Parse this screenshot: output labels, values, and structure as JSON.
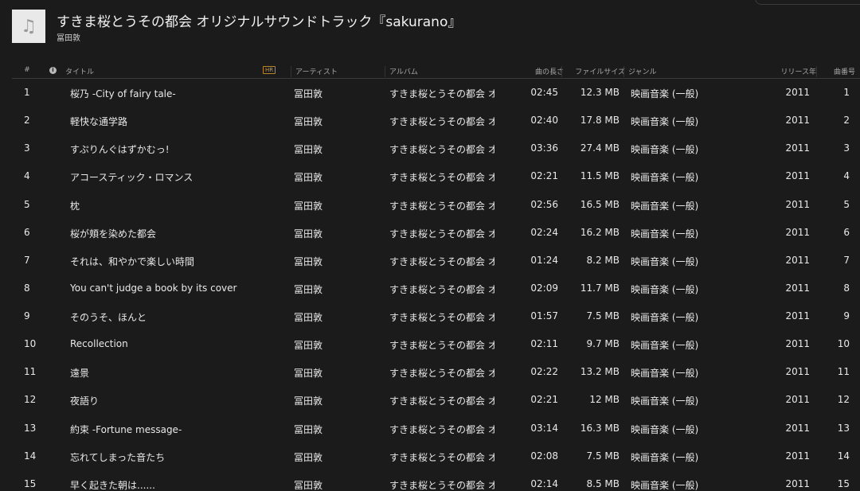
{
  "header": {
    "album_art_icon": "music-note-icon",
    "album_title": "すきま桜とうその都会 オリジナルサウンドトラック『sakurano』",
    "album_artist": "冨田敦"
  },
  "columns": {
    "num": "#",
    "info_icon": "info-icon",
    "title": "タイトル",
    "hr": "HR",
    "artist": "アーティスト",
    "album": "アルバム",
    "length": "曲の長さ",
    "size": "ファイルサイズ",
    "genre": "ジャンル",
    "year": "リリース年",
    "track": "曲番号"
  },
  "tracks": [
    {
      "num": "1",
      "title": "桜乃 -City of fairy tale-",
      "artist": "冨田敦",
      "album": "すきま桜とうその都会 オ...",
      "length": "02:45",
      "size": "12.3 MB",
      "genre": "映画音楽 (一般)",
      "year": "2011",
      "track": "1"
    },
    {
      "num": "2",
      "title": "軽快な通学路",
      "artist": "冨田敦",
      "album": "すきま桜とうその都会 オ...",
      "length": "02:40",
      "size": "17.8 MB",
      "genre": "映画音楽 (一般)",
      "year": "2011",
      "track": "2"
    },
    {
      "num": "3",
      "title": "すぷりんぐはずかむっ!",
      "artist": "冨田敦",
      "album": "すきま桜とうその都会 オ...",
      "length": "03:36",
      "size": "27.4 MB",
      "genre": "映画音楽 (一般)",
      "year": "2011",
      "track": "3"
    },
    {
      "num": "4",
      "title": "アコースティック・ロマンス",
      "artist": "冨田敦",
      "album": "すきま桜とうその都会 オ...",
      "length": "02:21",
      "size": "11.5 MB",
      "genre": "映画音楽 (一般)",
      "year": "2011",
      "track": "4"
    },
    {
      "num": "5",
      "title": "枕",
      "artist": "冨田敦",
      "album": "すきま桜とうその都会 オ...",
      "length": "02:56",
      "size": "16.5 MB",
      "genre": "映画音楽 (一般)",
      "year": "2011",
      "track": "5"
    },
    {
      "num": "6",
      "title": "桜が頬を染めた都会",
      "artist": "冨田敦",
      "album": "すきま桜とうその都会 オ...",
      "length": "02:24",
      "size": "16.2 MB",
      "genre": "映画音楽 (一般)",
      "year": "2011",
      "track": "6"
    },
    {
      "num": "7",
      "title": "それは、和やかで楽しい時間",
      "artist": "冨田敦",
      "album": "すきま桜とうその都会 オ...",
      "length": "01:24",
      "size": "8.2 MB",
      "genre": "映画音楽 (一般)",
      "year": "2011",
      "track": "7"
    },
    {
      "num": "8",
      "title": "You can't judge a book by its cover",
      "artist": "冨田敦",
      "album": "すきま桜とうその都会 オ...",
      "length": "02:09",
      "size": "11.7 MB",
      "genre": "映画音楽 (一般)",
      "year": "2011",
      "track": "8"
    },
    {
      "num": "9",
      "title": "そのうそ、ほんと",
      "artist": "冨田敦",
      "album": "すきま桜とうその都会 オ...",
      "length": "01:57",
      "size": "7.5 MB",
      "genre": "映画音楽 (一般)",
      "year": "2011",
      "track": "9"
    },
    {
      "num": "10",
      "title": "Recollection",
      "artist": "冨田敦",
      "album": "すきま桜とうその都会 オ...",
      "length": "02:11",
      "size": "9.7 MB",
      "genre": "映画音楽 (一般)",
      "year": "2011",
      "track": "10"
    },
    {
      "num": "11",
      "title": "遠景",
      "artist": "冨田敦",
      "album": "すきま桜とうその都会 オ...",
      "length": "02:22",
      "size": "13.2 MB",
      "genre": "映画音楽 (一般)",
      "year": "2011",
      "track": "11"
    },
    {
      "num": "12",
      "title": "夜語り",
      "artist": "冨田敦",
      "album": "すきま桜とうその都会 オ...",
      "length": "02:21",
      "size": "12 MB",
      "genre": "映画音楽 (一般)",
      "year": "2011",
      "track": "12"
    },
    {
      "num": "13",
      "title": "約束 -Fortune message-",
      "artist": "冨田敦",
      "album": "すきま桜とうその都会 オ...",
      "length": "03:14",
      "size": "16.3 MB",
      "genre": "映画音楽 (一般)",
      "year": "2011",
      "track": "13"
    },
    {
      "num": "14",
      "title": "忘れてしまった音たち",
      "artist": "冨田敦",
      "album": "すきま桜とうその都会 オ...",
      "length": "02:08",
      "size": "7.5 MB",
      "genre": "映画音楽 (一般)",
      "year": "2011",
      "track": "14"
    },
    {
      "num": "15",
      "title": "早く起きた朝は......",
      "artist": "冨田敦",
      "album": "すきま桜とうその都会 オ...",
      "length": "02:14",
      "size": "8.5 MB",
      "genre": "映画音楽 (一般)",
      "year": "2011",
      "track": "15"
    }
  ]
}
